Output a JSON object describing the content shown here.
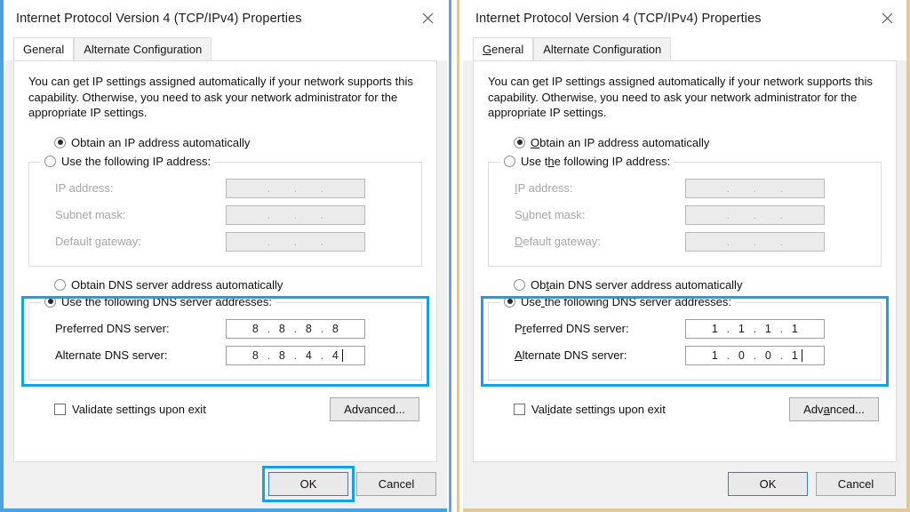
{
  "panels": [
    {
      "id": "left",
      "title": "Internet Protocol Version 4 (TCP/IPv4) Properties",
      "close_icon": "close-icon",
      "tabs": [
        {
          "label": "General",
          "active": true
        },
        {
          "label": "Alternate Configuration",
          "active": false
        }
      ],
      "intro": "You can get IP settings assigned automatically if your network supports this capability. Otherwise, you need to ask your network administrator for the appropriate IP settings.",
      "ip": {
        "obtain_label": "Obtain an IP address automatically",
        "obtain_selected": true,
        "manual_label": "Use the following IP address:",
        "manual_selected": false,
        "fields": [
          {
            "label": "IP address:",
            "octets": [
              "",
              "",
              "",
              ""
            ]
          },
          {
            "label": "Subnet mask:",
            "octets": [
              "",
              "",
              "",
              ""
            ]
          },
          {
            "label": "Default gateway:",
            "octets": [
              "",
              "",
              "",
              ""
            ]
          }
        ]
      },
      "dns": {
        "obtain_label": "Obtain DNS server address automatically",
        "obtain_selected": false,
        "manual_label": "Use the following DNS server addresses:",
        "manual_selected": true,
        "highlighted": true,
        "fields": [
          {
            "label": "Preferred DNS server:",
            "octets": [
              "8",
              "8",
              "8",
              "8"
            ],
            "caret": false
          },
          {
            "label": "Alternate DNS server:",
            "octets": [
              "8",
              "8",
              "4",
              "4"
            ],
            "caret": true
          }
        ]
      },
      "validate_label": "Validate settings upon exit",
      "validate_checked": false,
      "advanced_label": "Advanced...",
      "ok_label": "OK",
      "cancel_label": "Cancel",
      "ok_highlighted": true,
      "accelerators": false
    },
    {
      "id": "right",
      "title": "Internet Protocol Version 4 (TCP/IPv4) Properties",
      "close_icon": "close-icon",
      "tabs": [
        {
          "label": "General",
          "active": true
        },
        {
          "label": "Alternate Configuration",
          "active": false
        }
      ],
      "intro": "You can get IP settings assigned automatically if your network supports this capability. Otherwise, you need to ask your network administrator for the appropriate IP settings.",
      "ip": {
        "obtain_label": "Obtain an IP address automatically",
        "obtain_selected": true,
        "manual_label": "Use the following IP address:",
        "manual_selected": false,
        "fields": [
          {
            "label": "IP address:",
            "octets": [
              "",
              "",
              "",
              ""
            ]
          },
          {
            "label": "Subnet mask:",
            "octets": [
              "",
              "",
              "",
              ""
            ]
          },
          {
            "label": "Default gateway:",
            "octets": [
              "",
              "",
              "",
              ""
            ]
          }
        ]
      },
      "dns": {
        "obtain_label": "Obtain DNS server address automatically",
        "obtain_selected": false,
        "manual_label": "Use the following DNS server addresses:",
        "manual_selected": true,
        "highlighted": true,
        "fields": [
          {
            "label": "Preferred DNS server:",
            "octets": [
              "1",
              "1",
              "1",
              "1"
            ],
            "caret": false
          },
          {
            "label": "Alternate DNS server:",
            "octets": [
              "1",
              "0",
              "0",
              "1"
            ],
            "caret": true
          }
        ]
      },
      "validate_label": "Validate settings upon exit",
      "validate_checked": false,
      "advanced_label": "Advanced...",
      "ok_label": "OK",
      "cancel_label": "Cancel",
      "ok_highlighted": false,
      "accelerators": true
    }
  ],
  "colors": {
    "highlight_blue": "#16a0e6",
    "window_border_left": "#4aa3e0",
    "window_border_right": "#e3c89a",
    "focus_border": "#2f7fd0"
  }
}
